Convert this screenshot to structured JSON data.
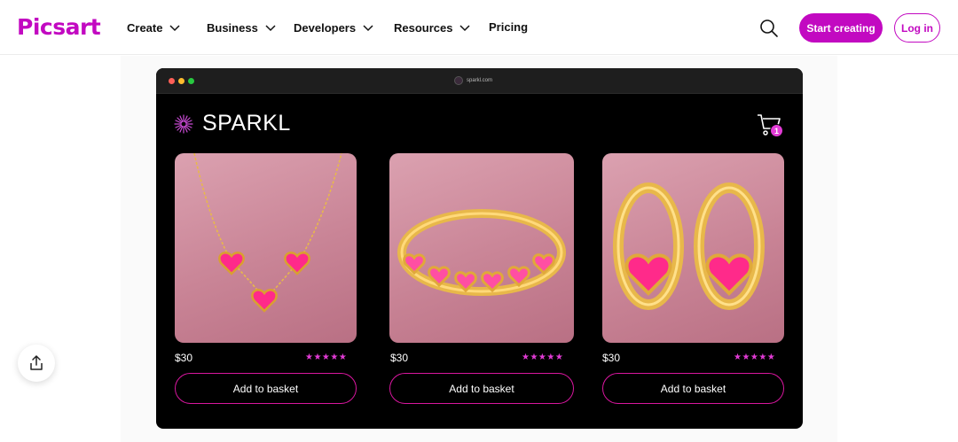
{
  "brand": {
    "logo_text": "Picsart",
    "color": "#c209c1"
  },
  "nav": {
    "items": [
      {
        "label": "Create",
        "has_dropdown": true
      },
      {
        "label": "Business",
        "has_dropdown": true
      },
      {
        "label": "Developers",
        "has_dropdown": true
      },
      {
        "label": "Resources",
        "has_dropdown": true
      },
      {
        "label": "Pricing",
        "has_dropdown": false
      }
    ],
    "search_icon": "search-icon",
    "start_label": "Start creating",
    "login_label": "Log in"
  },
  "mock_browser": {
    "url": "sparkl.com",
    "dot_colors": [
      "#ff5f57",
      "#febc2e",
      "#28c840"
    ]
  },
  "store": {
    "name": "SPARKL",
    "cart_count": "1",
    "accent": "#e23bd5",
    "products": [
      {
        "name": "necklace",
        "price": "$30",
        "stars": "★★★★★",
        "rating": 5,
        "button": "Add to basket"
      },
      {
        "name": "ring",
        "price": "$30",
        "stars": "★★★★★",
        "rating": 5,
        "button": "Add to basket"
      },
      {
        "name": "earrings",
        "price": "$30",
        "stars": "★★★★★",
        "rating": 5,
        "button": "Add to basket"
      }
    ]
  },
  "share_icon": "share-icon"
}
